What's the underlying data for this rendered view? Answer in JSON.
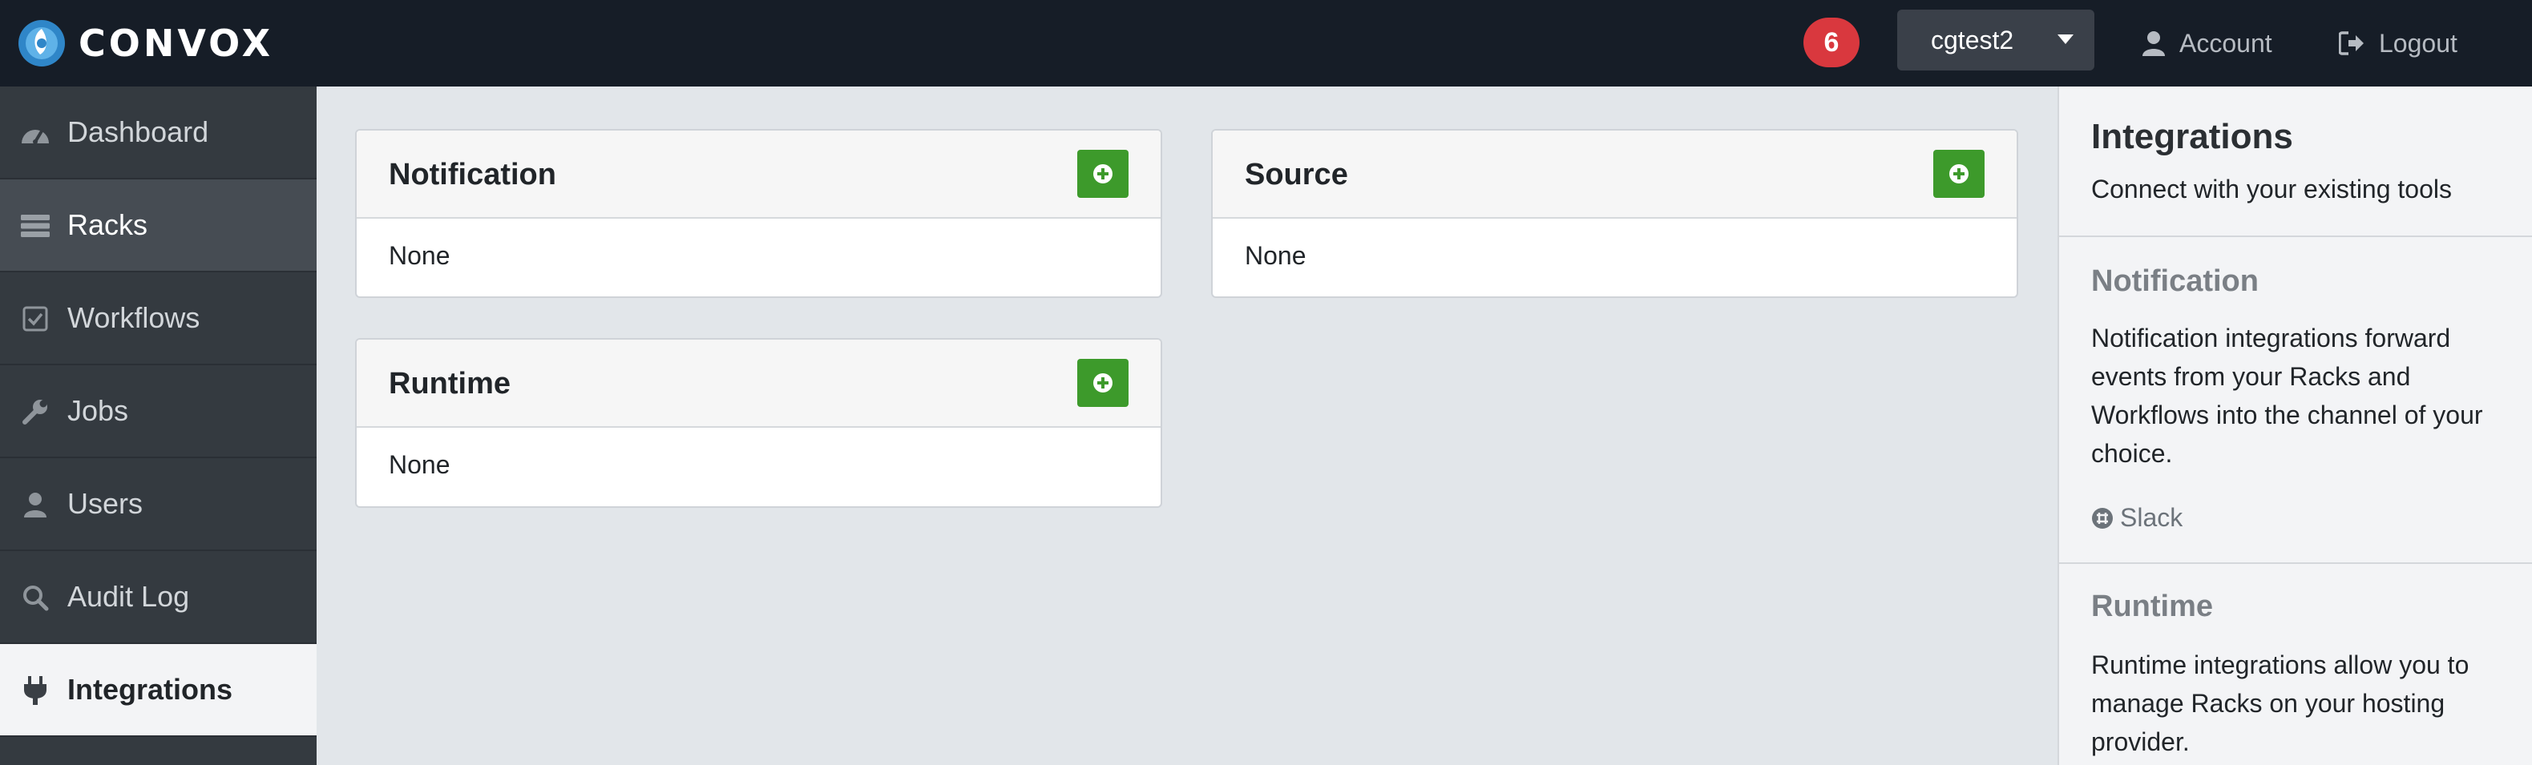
{
  "brand": {
    "name": "CONVOX"
  },
  "header": {
    "badge_count": "6",
    "rack_name": "cgtest2",
    "account_label": "Account",
    "logout_label": "Logout"
  },
  "sidebar": {
    "items": [
      {
        "label": "Dashboard",
        "icon": "dashboard-icon"
      },
      {
        "label": "Racks",
        "icon": "server-icon"
      },
      {
        "label": "Workflows",
        "icon": "checkbox-icon"
      },
      {
        "label": "Jobs",
        "icon": "wrench-icon"
      },
      {
        "label": "Users",
        "icon": "user-icon"
      },
      {
        "label": "Audit Log",
        "icon": "search-icon"
      },
      {
        "label": "Integrations",
        "icon": "plug-icon"
      }
    ]
  },
  "cards": {
    "notification": {
      "title": "Notification",
      "body": "None"
    },
    "source": {
      "title": "Source",
      "body": "None"
    },
    "runtime": {
      "title": "Runtime",
      "body": "None"
    }
  },
  "panel": {
    "title": "Integrations",
    "subtitle": "Connect with your existing tools",
    "notification_title": "Notification",
    "notification_text": "Notification integrations forward events from your Racks and Workflows into the channel of your choice.",
    "slack_label": "Slack",
    "runtime_title": "Runtime",
    "runtime_text": "Runtime integrations allow you to manage Racks on your hosting provider."
  },
  "colors": {
    "topbar": "#161d27",
    "sidebar": "#343a40",
    "badge": "#d9383e",
    "add_button": "#3d9a2b"
  }
}
